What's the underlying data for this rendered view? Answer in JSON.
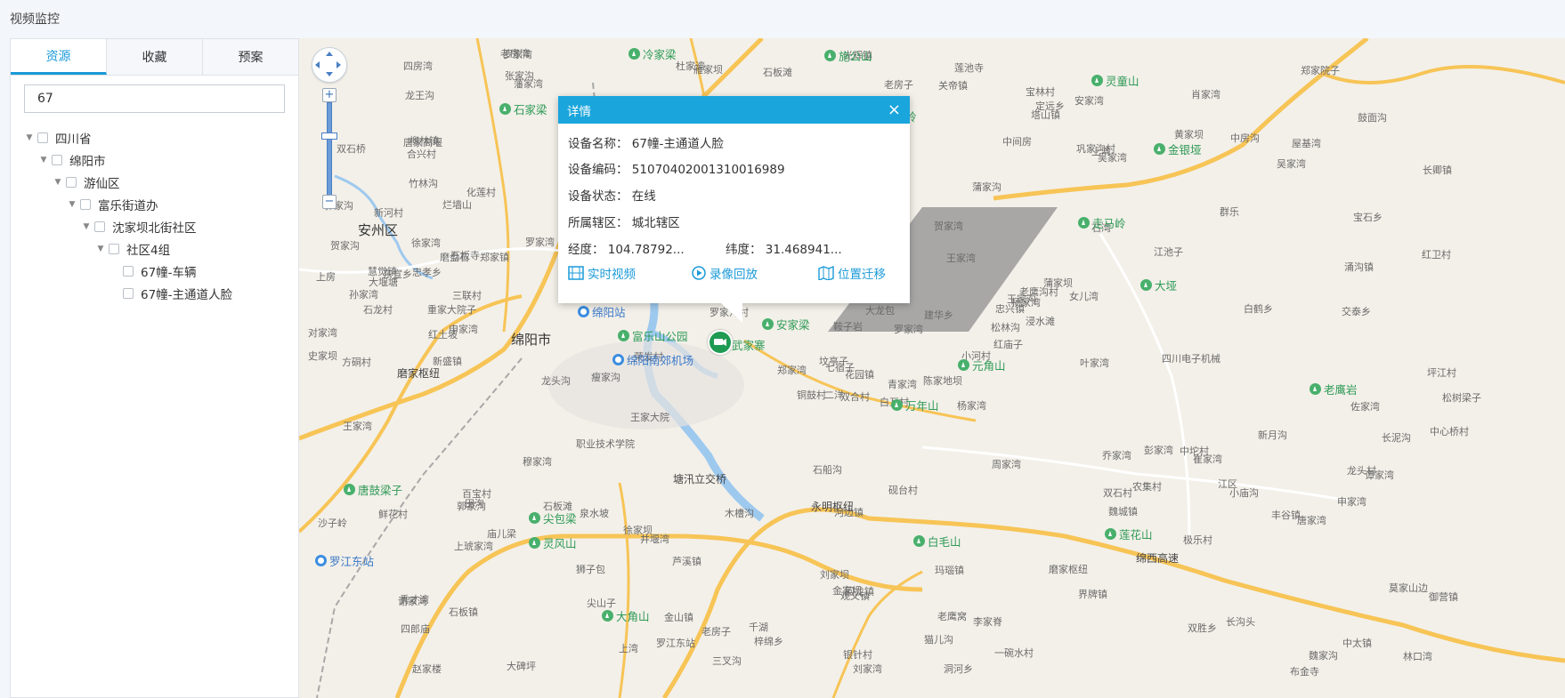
{
  "page_title": "视频监控",
  "tabs": [
    {
      "label": "资源",
      "active": true
    },
    {
      "label": "收藏",
      "active": false
    },
    {
      "label": "预案",
      "active": false
    }
  ],
  "search": {
    "value": "67"
  },
  "tree": [
    {
      "label": "四川省",
      "level": 0,
      "expanded": true
    },
    {
      "label": "绵阳市",
      "level": 1,
      "expanded": true
    },
    {
      "label": "游仙区",
      "level": 2,
      "expanded": true
    },
    {
      "label": "富乐街道办",
      "level": 3,
      "expanded": true
    },
    {
      "label": "沈家坝北街社区",
      "level": 4,
      "expanded": true
    },
    {
      "label": "社区4组",
      "level": 5,
      "expanded": true
    },
    {
      "label": "67幢-车辆",
      "level": 6,
      "leaf": true
    },
    {
      "label": "67幢-主通道人脸",
      "level": 6,
      "leaf": true
    }
  ],
  "popup": {
    "title": "详情",
    "device_name_label": "设备名称：",
    "device_name": "67幢-主通道人脸",
    "device_code_label": "设备编码：",
    "device_code": "51070402001310016989",
    "device_status_label": "设备状态：",
    "device_status": "在线",
    "district_label": "所属辖区：",
    "district": "城北辖区",
    "lng_label": "经度：",
    "lng": "104.78792...",
    "lat_label": "纬度：",
    "lat": "31.468941...",
    "link_live": "实时视频",
    "link_playback": "录像回放",
    "link_move": "位置迁移"
  },
  "map_labels": {
    "big": [
      "绵阳市",
      "安州区"
    ],
    "mid": [
      "磨家枢纽",
      "塘汛立交桥",
      "永明枢纽",
      "绵西高速"
    ],
    "places": [
      "白互村",
      "烂墙山",
      "七宿子",
      "秀才湾",
      "忠兴镇",
      "井堰湾",
      "安家湾",
      "上湾",
      "小河村",
      "藩家湾",
      "林口湾",
      "申家湾",
      "长卿镇",
      "铜鼓村",
      "石湾",
      "大碑坪",
      "王家湾",
      "庙儿梁",
      "四郎庙",
      "尖山子",
      "杨家湾",
      "崔家湾",
      "化莲村",
      "石龙村",
      "乔家湾",
      "红卫村",
      "坟亭子",
      "刘家坝",
      "鞍子岩",
      "黄家坝",
      "徐家坝",
      "魏家沟",
      "莫家山边",
      "中坨村",
      "莲池寺",
      "魏城镇",
      "上湾",
      "上房",
      "松林沟",
      "赵家楼",
      "观义镇",
      "红庙子",
      "上琥家湾",
      "宝石乡",
      "双石桥",
      "农集村",
      "界牌镇",
      "狮子包",
      "张家沟",
      "四房湾",
      "玛瑙镇",
      "屋基湾",
      "老房子",
      "荣发村",
      "东宣乡",
      "中房沟",
      "老房湾",
      "定远乡",
      "大龙包",
      "沙子岭",
      "河边镇",
      "老房子",
      "彭家湾",
      "谢家湾",
      "龙王沟",
      "罗家湾",
      "王家湾",
      "老鹰窝",
      "建华乡",
      "石板镇",
      "叶家湾",
      "谭家湾",
      "银针村",
      "交泰乡",
      "砚台村",
      "长沟头",
      "洞河乡",
      "磨家枢纽",
      "松树梁子",
      "女儿湾",
      "极乐村",
      "罗家湾",
      "申家湾",
      "大堰塘",
      "刘家湾",
      "巩家沟村",
      "吴家湾",
      "龙头沟",
      "杜家湾",
      "坪江村",
      "孙家湾",
      "穆家湾",
      "泉水坡",
      "金山镇",
      "王家沟",
      "吴家湾",
      "罗家沟村",
      "佐家湾",
      "合兴村",
      "郑家湾",
      "雁家坝",
      "鲜花村",
      "双合村",
      "鼓面沟",
      "石板滩",
      "郭家沟",
      "郑家院子",
      "贺家湾",
      "四川电子机械",
      "职业技术学院",
      "中太镇",
      "梓绵乡",
      "白鹤乡",
      "竹林沟",
      "田沟",
      "一碗水村",
      "长泥沟",
      "小庙沟",
      "王家大院",
      "百宝村",
      "中心桥村",
      "杨家湾",
      "三联村",
      "丰谷镇",
      "陈家地坝",
      "老鹰沟村",
      "柳林镇",
      "千湖",
      "双胜乡",
      "金家坝",
      "涌沟镇",
      "慧觉镇",
      "三叉沟",
      "新月沟",
      "关帝镇",
      "瘦家沟",
      "蒲家沟",
      "周家湾",
      "史家坝",
      "光辉镇",
      "塔山镇",
      "徐家湾",
      "石船沟",
      "御营镇",
      "罗家湾",
      "布金寺",
      "唐家湾",
      "李家脊",
      "贺家沟",
      "宝林村",
      "蒲家坝",
      "罗江东站",
      "中间房",
      "双石村",
      "郭家沟",
      "石板寺",
      "新河村",
      "青家湾",
      "猫儿沟",
      "忠孝乡",
      "唐家高堰",
      "郑家镇",
      "磨盘石",
      "重家大院子",
      "芦溪镇",
      "花园镇",
      "龙头村",
      "木槽沟",
      "群乐",
      "浸水滩",
      "回龙镇",
      "新盛镇",
      "江区",
      "石板滩",
      "红土坡",
      "肖家湾",
      "对家湾",
      "江池子",
      "方硐村",
      "二洋"
    ],
    "pois": [
      "冷家梁",
      "施公山",
      "灵童山",
      "尖包岭",
      "金银垭",
      "走马岭",
      "大垭",
      "道子梁",
      "安家梁",
      "武家寨",
      "元角山",
      "万年山",
      "老鹰岩",
      "唐鼓梁子",
      "尖包梁",
      "灵风山",
      "白毛山",
      "莲花山",
      "大角山",
      "富乐山公园",
      "石家梁"
    ],
    "pois_blue": [
      "绵阳站",
      "绵阳南郊机场",
      "罗江东站"
    ]
  }
}
